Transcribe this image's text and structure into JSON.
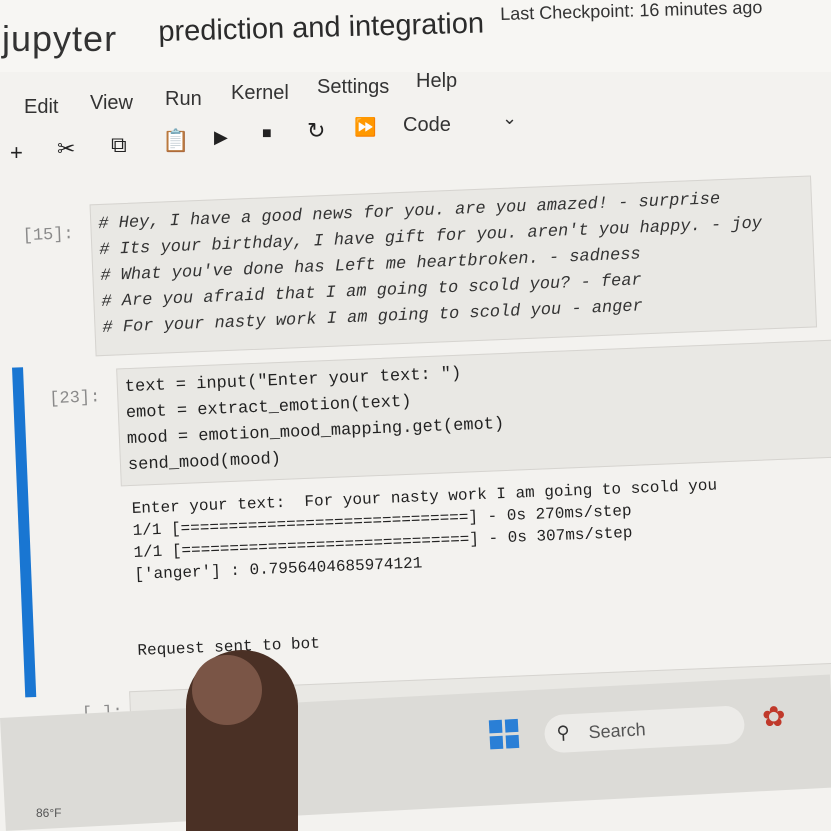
{
  "header": {
    "logo_text": "jupyter",
    "notebook_title": "prediction and integration",
    "checkpoint": "Last Checkpoint: 16 minutes ago"
  },
  "menu": [
    "Edit",
    "View",
    "Run",
    "Kernel",
    "Settings",
    "Help"
  ],
  "toolbar": {
    "cell_type": "Code"
  },
  "cells": [
    {
      "prompt": "[15]:",
      "lines": [
        "# Hey, I have a good news for you. are you amazed! - surprise",
        "# Its your birthday, I have gift for you. aren't you happy. - joy",
        "# What you've done has Left me heartbroken. - sadness",
        "# Are you afraid that I am going to scold you? - fear",
        "# For your nasty work I am going to scold you - anger"
      ]
    },
    {
      "prompt": "[23]:",
      "lines": [
        "text = input(\"Enter your text: \")",
        "emot = extract_emotion(text)",
        "mood = emotion_mood_mapping.get(emot)",
        "send_mood(mood)"
      ],
      "output": [
        "Enter your text:  For your nasty work I am going to scold you",
        "1/1 [==============================] - 0s 270ms/step",
        "1/1 [==============================] - 0s 307ms/step",
        "['anger'] : 0.7956404685974121"
      ],
      "output2": "Request sent to bot"
    },
    {
      "prompt": "[ ]:"
    }
  ],
  "taskbar": {
    "search_label": "Search",
    "weather": "86°F"
  },
  "colors": {
    "accent": "#1976d2",
    "background": "#f3f2ef",
    "cell_bg": "#e9e8e4"
  }
}
